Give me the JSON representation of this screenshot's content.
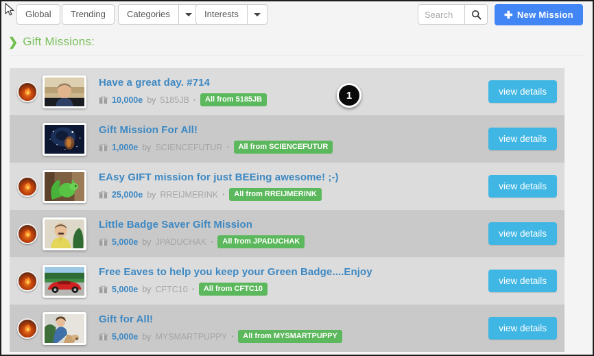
{
  "toolbar": {
    "global_label": "Global",
    "trending_label": "Trending",
    "categories_label": "Categories",
    "categories_caret": "chevron-down-icon",
    "interests_label": "Interests",
    "interests_caret": "chevron-down-icon",
    "search_placeholder": "Search",
    "search_value": "",
    "search_icon": "search-icon",
    "new_mission_plus": "✚",
    "new_mission_label": "New Mission",
    "new_mission_color": "#4285f4"
  },
  "section": {
    "chevron": "❯",
    "title": "Gift Missions:",
    "title_color": "#7ac15b"
  },
  "callouts": [
    {
      "label": "1"
    }
  ],
  "colors": {
    "row_odd": "#dcdcdc",
    "row_even": "#c9c9c9",
    "title_link": "#3d88c2",
    "badge_green": "#5cb85c",
    "view_button": "#3fb6e3",
    "page_background": "#f4f4f4"
  },
  "missions": [
    {
      "flame_icon": "flame-badge-icon",
      "has_flame": true,
      "thumbnail": "man-in-blue-shirt-photo",
      "title": "Have a great day. #714",
      "gift_icon": "gift-icon",
      "amount": "10,000e",
      "by_word": "by",
      "author": "5185JB",
      "dot": "·",
      "badge_label": "All from 5185JB",
      "action_label": "view details"
    },
    {
      "flame_icon": "flame-badge-icon",
      "has_flame": false,
      "thumbnail": "galaxy-space-photo",
      "title": "Gift Mission For All!",
      "gift_icon": "gift-icon",
      "amount": "1,000e",
      "by_word": "by",
      "author": "SCIENCEFUTUR",
      "dot": "·",
      "badge_label": "All from SCIENCEFUTUR",
      "action_label": "view details"
    },
    {
      "flame_icon": "flame-badge-icon",
      "has_flame": true,
      "thumbnail": "green-squirrel-photo",
      "title": "EAsy GIFT mission for just BEEing awesome! ;-)",
      "gift_icon": "gift-icon",
      "amount": "25,000e",
      "by_word": "by",
      "author": "RREIJMERINK",
      "dot": "·",
      "badge_label": "All from RREIJMERINK",
      "action_label": "view details"
    },
    {
      "flame_icon": "flame-badge-icon",
      "has_flame": true,
      "thumbnail": "man-in-yellow-shirt-photo",
      "title": "Little Badge Saver Gift Mission",
      "gift_icon": "gift-icon",
      "amount": "5,000e",
      "by_word": "by",
      "author": "JPADUCHAK",
      "dot": "·",
      "badge_label": "All from JPADUCHAK",
      "action_label": "view details"
    },
    {
      "flame_icon": "flame-badge-icon",
      "has_flame": true,
      "thumbnail": "red-corvette-car-photo",
      "title": "Free Eaves to help you keep your Green Badge....Enjoy",
      "gift_icon": "gift-icon",
      "amount": "5,000e",
      "by_word": "by",
      "author": "CFTC10",
      "dot": "·",
      "badge_label": "All from CFTC10",
      "action_label": "view details"
    },
    {
      "flame_icon": "flame-badge-icon",
      "has_flame": true,
      "thumbnail": "woman-with-dog-photo",
      "title": "Gift for All!",
      "gift_icon": "gift-icon",
      "amount": "5,000e",
      "by_word": "by",
      "author": "MYSMARTPUPPY",
      "dot": "·",
      "badge_label": "All from MYSMARTPUPPY",
      "action_label": "view details"
    }
  ]
}
